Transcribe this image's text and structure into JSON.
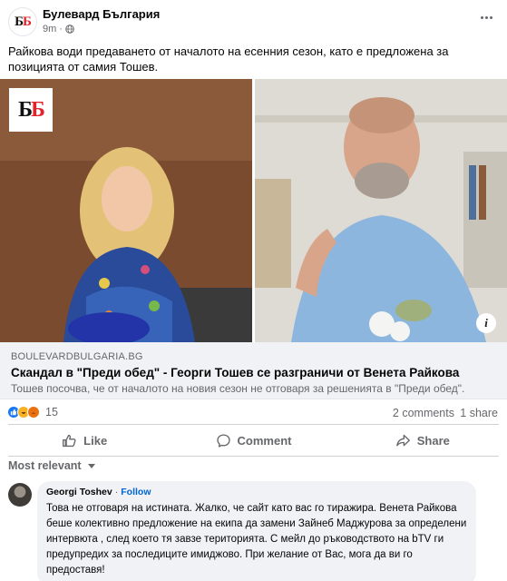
{
  "post": {
    "page_name": "Булевард България",
    "time": "9m",
    "audience_icon": "globe-icon",
    "text": "Райкова води предаването от началото на есенния сезон, като е предложена за позицията от самия Тошев."
  },
  "logo": {
    "text_black": "Б",
    "text_red": "Б"
  },
  "link_preview": {
    "domain": "BOULEVARDBULGARIA.BG",
    "title": "Скандал в \"Преди обед\" - Георги Тошев се разграничи от Венета Райкова",
    "description": "Тошев посочва, че от началото на новия сезон не отговаря за решенията в \"Преди обед\"."
  },
  "stats": {
    "reactions": [
      "like",
      "haha",
      "angry"
    ],
    "reaction_count": "15",
    "comments": "2 comments",
    "shares": "1 share"
  },
  "actions": {
    "like": "Like",
    "comment": "Comment",
    "share": "Share"
  },
  "comments_sort": "Most relevant",
  "comment": {
    "author": "Georgi Toshev",
    "separator": "·",
    "follow": "Follow",
    "text": "Това не отговаря на истината. Жалко, че сайт като вас го тиражира. Венета Райкова беше колективно предложение на екипа да замени Зайнеб Маджурова за определени интервюта , след което тя завзе територията. С мейл до ръководството на bTV ги предупредих за последиците имиджово. При желание от Вас, мога да ви го предоставя!"
  },
  "colors": {
    "accent": "#1877f2",
    "link": "#0064d1",
    "muted": "#65676b",
    "bubble": "#f0f2f5",
    "logo_red": "#e0242c"
  }
}
